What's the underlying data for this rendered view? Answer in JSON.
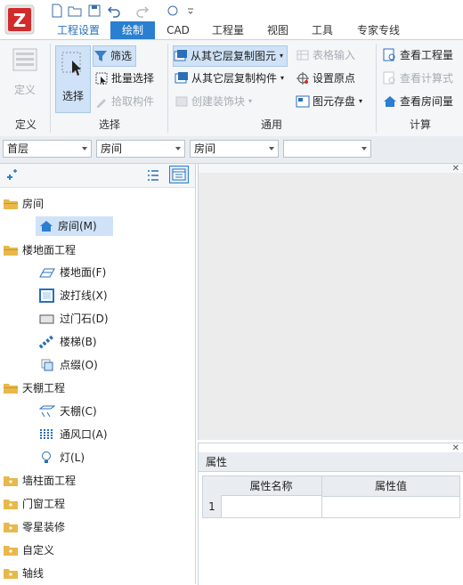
{
  "tabs": [
    "工程设置",
    "绘制",
    "工程量",
    "CAD",
    "视图",
    "工具",
    "专家专线"
  ],
  "active_tab": "绘制",
  "ribbon": {
    "define_group": {
      "button": "定义",
      "label": "定义"
    },
    "select_group": {
      "select": "选择",
      "filter": "筛选",
      "batch_select": "批量选择",
      "pick_component": "拾取构件",
      "label": "选择"
    },
    "common_group": {
      "copy_from_floor_elements": "从其它层复制图元",
      "copy_from_floor_components": "从其它层复制构件",
      "create_decoration": "创建装饰块",
      "table_input": "表格输入",
      "set_origin": "设置原点",
      "element_save": "图元存盘",
      "label": "通用"
    },
    "calc_group": {
      "view_quantity": "查看工程量",
      "view_formula": "查看计算式",
      "view_room_quantity": "查看房间量",
      "label": "计算"
    }
  },
  "filters": {
    "floor": "首层",
    "category": "房间",
    "component": "房间",
    "extra": ""
  },
  "tree": {
    "room": "房间",
    "room_item": "房间(M)",
    "floor_work": "楼地面工程",
    "floor_items": [
      "楼地面(F)",
      "波打线(X)",
      "过门石(D)",
      "楼梯(B)",
      "点缀(O)"
    ],
    "ceiling_work": "天棚工程",
    "ceiling_items": [
      "天棚(C)",
      "通风口(A)",
      "灯(L)"
    ],
    "others": [
      "墙柱面工程",
      "门窗工程",
      "零星装修",
      "自定义",
      "轴线"
    ]
  },
  "properties": {
    "title": "属性",
    "col_name": "属性名称",
    "col_value": "属性值",
    "row1": "1"
  },
  "colors": {
    "accent": "#2a7fd0",
    "folder": "#e8b84a"
  }
}
